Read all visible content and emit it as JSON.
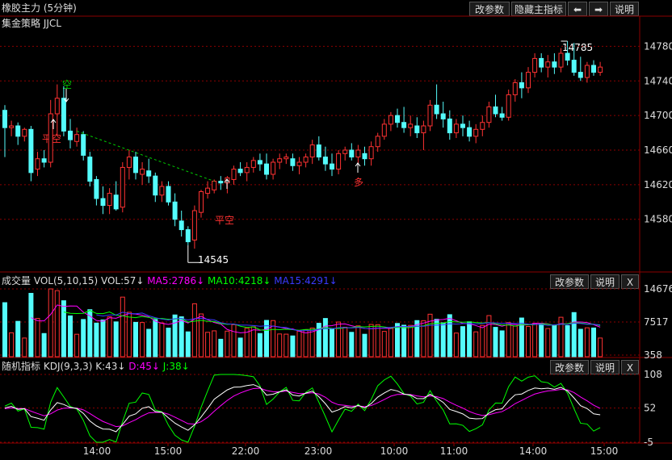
{
  "header": {
    "title": "橡胶主力 (5分钟)",
    "subtitle": "集金策略 JJCL",
    "buttons": {
      "change_params": "改参数",
      "hide_indicator": "隐藏主指标",
      "prev": "⬅",
      "next": "➡",
      "help": "说明"
    }
  },
  "colors": {
    "up": "#ff3232",
    "down": "#54fcfc",
    "ma5": "#ffffff",
    "ma10": "#ffff00",
    "ma15": "#ff00ff",
    "trend": "#00cc00",
    "grid": "#8b0000"
  },
  "panels": {
    "volume": {
      "label": "成交量",
      "params": "VOL(5,10,15)",
      "vol": "VOL:57↓",
      "ma5": "MA5:2786↓",
      "ma10": "MA10:4218↓",
      "ma15": "MA15:4291↓",
      "btn_params": "改参数",
      "btn_help": "说明",
      "btn_close": "X"
    },
    "kdj": {
      "label": "随机指标",
      "params": "KDJ(9,3,3)",
      "k": "K:43↓",
      "d": "D:45↓",
      "j": "J:38↓",
      "btn_params": "改参数",
      "btn_help": "说明",
      "btn_close": "X"
    }
  },
  "annotations": {
    "kong": "空",
    "pingkong1": "平空",
    "pingkong2": "平空",
    "duo": "多",
    "low_label": "14545",
    "high_label": "14785"
  },
  "chart_data": [
    {
      "type": "candlestick",
      "title": "橡胶主力 (5分钟)",
      "ylim": [
        14520,
        14800
      ],
      "yticks": [
        "14780",
        "14740",
        "14700",
        "14660",
        "14620",
        "14580"
      ],
      "xticks": [
        "14:00",
        "15:00",
        "22:00",
        "23:00",
        "10:00",
        "11:00",
        "14:00",
        "15:00"
      ],
      "ohlc": [
        [
          14706,
          14712,
          14652,
          14686
        ],
        [
          14686,
          14694,
          14676,
          14688
        ],
        [
          14688,
          14692,
          14666,
          14676
        ],
        [
          14676,
          14686,
          14670,
          14684
        ],
        [
          14684,
          14688,
          14624,
          14634
        ],
        [
          14638,
          14658,
          14630,
          14650
        ],
        [
          14650,
          14660,
          14640,
          14646
        ],
        [
          14646,
          14718,
          14640,
          14702
        ],
        [
          14702,
          14736,
          14676,
          14720
        ],
        [
          14720,
          14734,
          14676,
          14682
        ],
        [
          14682,
          14696,
          14662,
          14672
        ],
        [
          14670,
          14686,
          14664,
          14678
        ],
        [
          14678,
          14682,
          14648,
          14654
        ],
        [
          14652,
          14658,
          14618,
          14624
        ],
        [
          14626,
          14630,
          14596,
          14604
        ],
        [
          14604,
          14618,
          14586,
          14596
        ],
        [
          14596,
          14616,
          14586,
          14610
        ],
        [
          14608,
          14624,
          14590,
          14592
        ],
        [
          14594,
          14646,
          14588,
          14640
        ],
        [
          14640,
          14660,
          14626,
          14652
        ],
        [
          14652,
          14658,
          14626,
          14634
        ],
        [
          14632,
          14646,
          14620,
          14638
        ],
        [
          14636,
          14650,
          14622,
          14630
        ],
        [
          14630,
          14634,
          14600,
          14608
        ],
        [
          14608,
          14624,
          14600,
          14618
        ],
        [
          14618,
          14624,
          14596,
          14600
        ],
        [
          14600,
          14610,
          14572,
          14580
        ],
        [
          14578,
          14590,
          14560,
          14568
        ],
        [
          14568,
          14572,
          14550,
          14554
        ],
        [
          14556,
          14596,
          14546,
          14590
        ],
        [
          14588,
          14614,
          14582,
          14612
        ],
        [
          14610,
          14624,
          14604,
          14616
        ],
        [
          14614,
          14626,
          14610,
          14624
        ],
        [
          14624,
          14630,
          14614,
          14622
        ],
        [
          14622,
          14630,
          14610,
          14628
        ],
        [
          14626,
          14642,
          14620,
          14638
        ],
        [
          14638,
          14646,
          14630,
          14634
        ],
        [
          14634,
          14646,
          14624,
          14640
        ],
        [
          14640,
          14652,
          14634,
          14648
        ],
        [
          14648,
          14656,
          14636,
          14644
        ],
        [
          14644,
          14656,
          14626,
          14632
        ],
        [
          14632,
          14650,
          14626,
          14646
        ],
        [
          14646,
          14656,
          14638,
          14650
        ],
        [
          14650,
          14656,
          14644,
          14652
        ],
        [
          14650,
          14656,
          14636,
          14642
        ],
        [
          14642,
          14652,
          14632,
          14646
        ],
        [
          14646,
          14656,
          14640,
          14652
        ],
        [
          14652,
          14672,
          14644,
          14666
        ],
        [
          14666,
          14676,
          14648,
          14652
        ],
        [
          14652,
          14664,
          14636,
          14644
        ],
        [
          14644,
          14656,
          14630,
          14638
        ],
        [
          14638,
          14660,
          14632,
          14656
        ],
        [
          14656,
          14664,
          14648,
          14660
        ],
        [
          14660,
          14668,
          14648,
          14652
        ],
        [
          14652,
          14666,
          14644,
          14660
        ],
        [
          14656,
          14664,
          14642,
          14650
        ],
        [
          14650,
          14670,
          14642,
          14664
        ],
        [
          14664,
          14680,
          14658,
          14676
        ],
        [
          14676,
          14696,
          14672,
          14690
        ],
        [
          14690,
          14704,
          14682,
          14700
        ],
        [
          14700,
          14708,
          14686,
          14692
        ],
        [
          14692,
          14710,
          14680,
          14686
        ],
        [
          14686,
          14700,
          14676,
          14690
        ],
        [
          14688,
          14698,
          14674,
          14680
        ],
        [
          14680,
          14694,
          14660,
          14688
        ],
        [
          14688,
          14718,
          14682,
          14712
        ],
        [
          14712,
          14736,
          14696,
          14702
        ],
        [
          14702,
          14716,
          14686,
          14696
        ],
        [
          14696,
          14706,
          14672,
          14680
        ],
        [
          14680,
          14696,
          14674,
          14690
        ],
        [
          14690,
          14700,
          14676,
          14686
        ],
        [
          14686,
          14694,
          14670,
          14676
        ],
        [
          14676,
          14690,
          14668,
          14684
        ],
        [
          14684,
          14700,
          14676,
          14692
        ],
        [
          14692,
          14716,
          14686,
          14710
        ],
        [
          14710,
          14724,
          14698,
          14702
        ],
        [
          14702,
          14710,
          14694,
          14698
        ],
        [
          14698,
          14730,
          14694,
          14724
        ],
        [
          14724,
          14742,
          14716,
          14738
        ],
        [
          14738,
          14750,
          14720,
          14732
        ],
        [
          14732,
          14756,
          14726,
          14750
        ],
        [
          14750,
          14772,
          14744,
          14766
        ],
        [
          14766,
          14772,
          14750,
          14756
        ],
        [
          14756,
          14770,
          14744,
          14762
        ],
        [
          14762,
          14772,
          14748,
          14756
        ],
        [
          14756,
          14778,
          14750,
          14772
        ],
        [
          14772,
          14786,
          14758,
          14764
        ],
        [
          14764,
          14784,
          14746,
          14750
        ],
        [
          14750,
          14768,
          14740,
          14744
        ],
        [
          14744,
          14762,
          14738,
          14758
        ],
        [
          14758,
          14764,
          14746,
          14750
        ],
        [
          14750,
          14762,
          14746,
          14756
        ]
      ],
      "marked_low": 14545,
      "marked_high": 14785
    },
    {
      "type": "bar",
      "title": "VOL(5,10,15)",
      "yticks": [
        "14676",
        "7517",
        "358"
      ],
      "ylim": [
        0,
        14676
      ]
    },
    {
      "type": "line",
      "title": "KDJ(9,3,3)",
      "yticks": [
        "108",
        "52",
        "-5"
      ],
      "ylim": [
        -5,
        108
      ]
    }
  ]
}
